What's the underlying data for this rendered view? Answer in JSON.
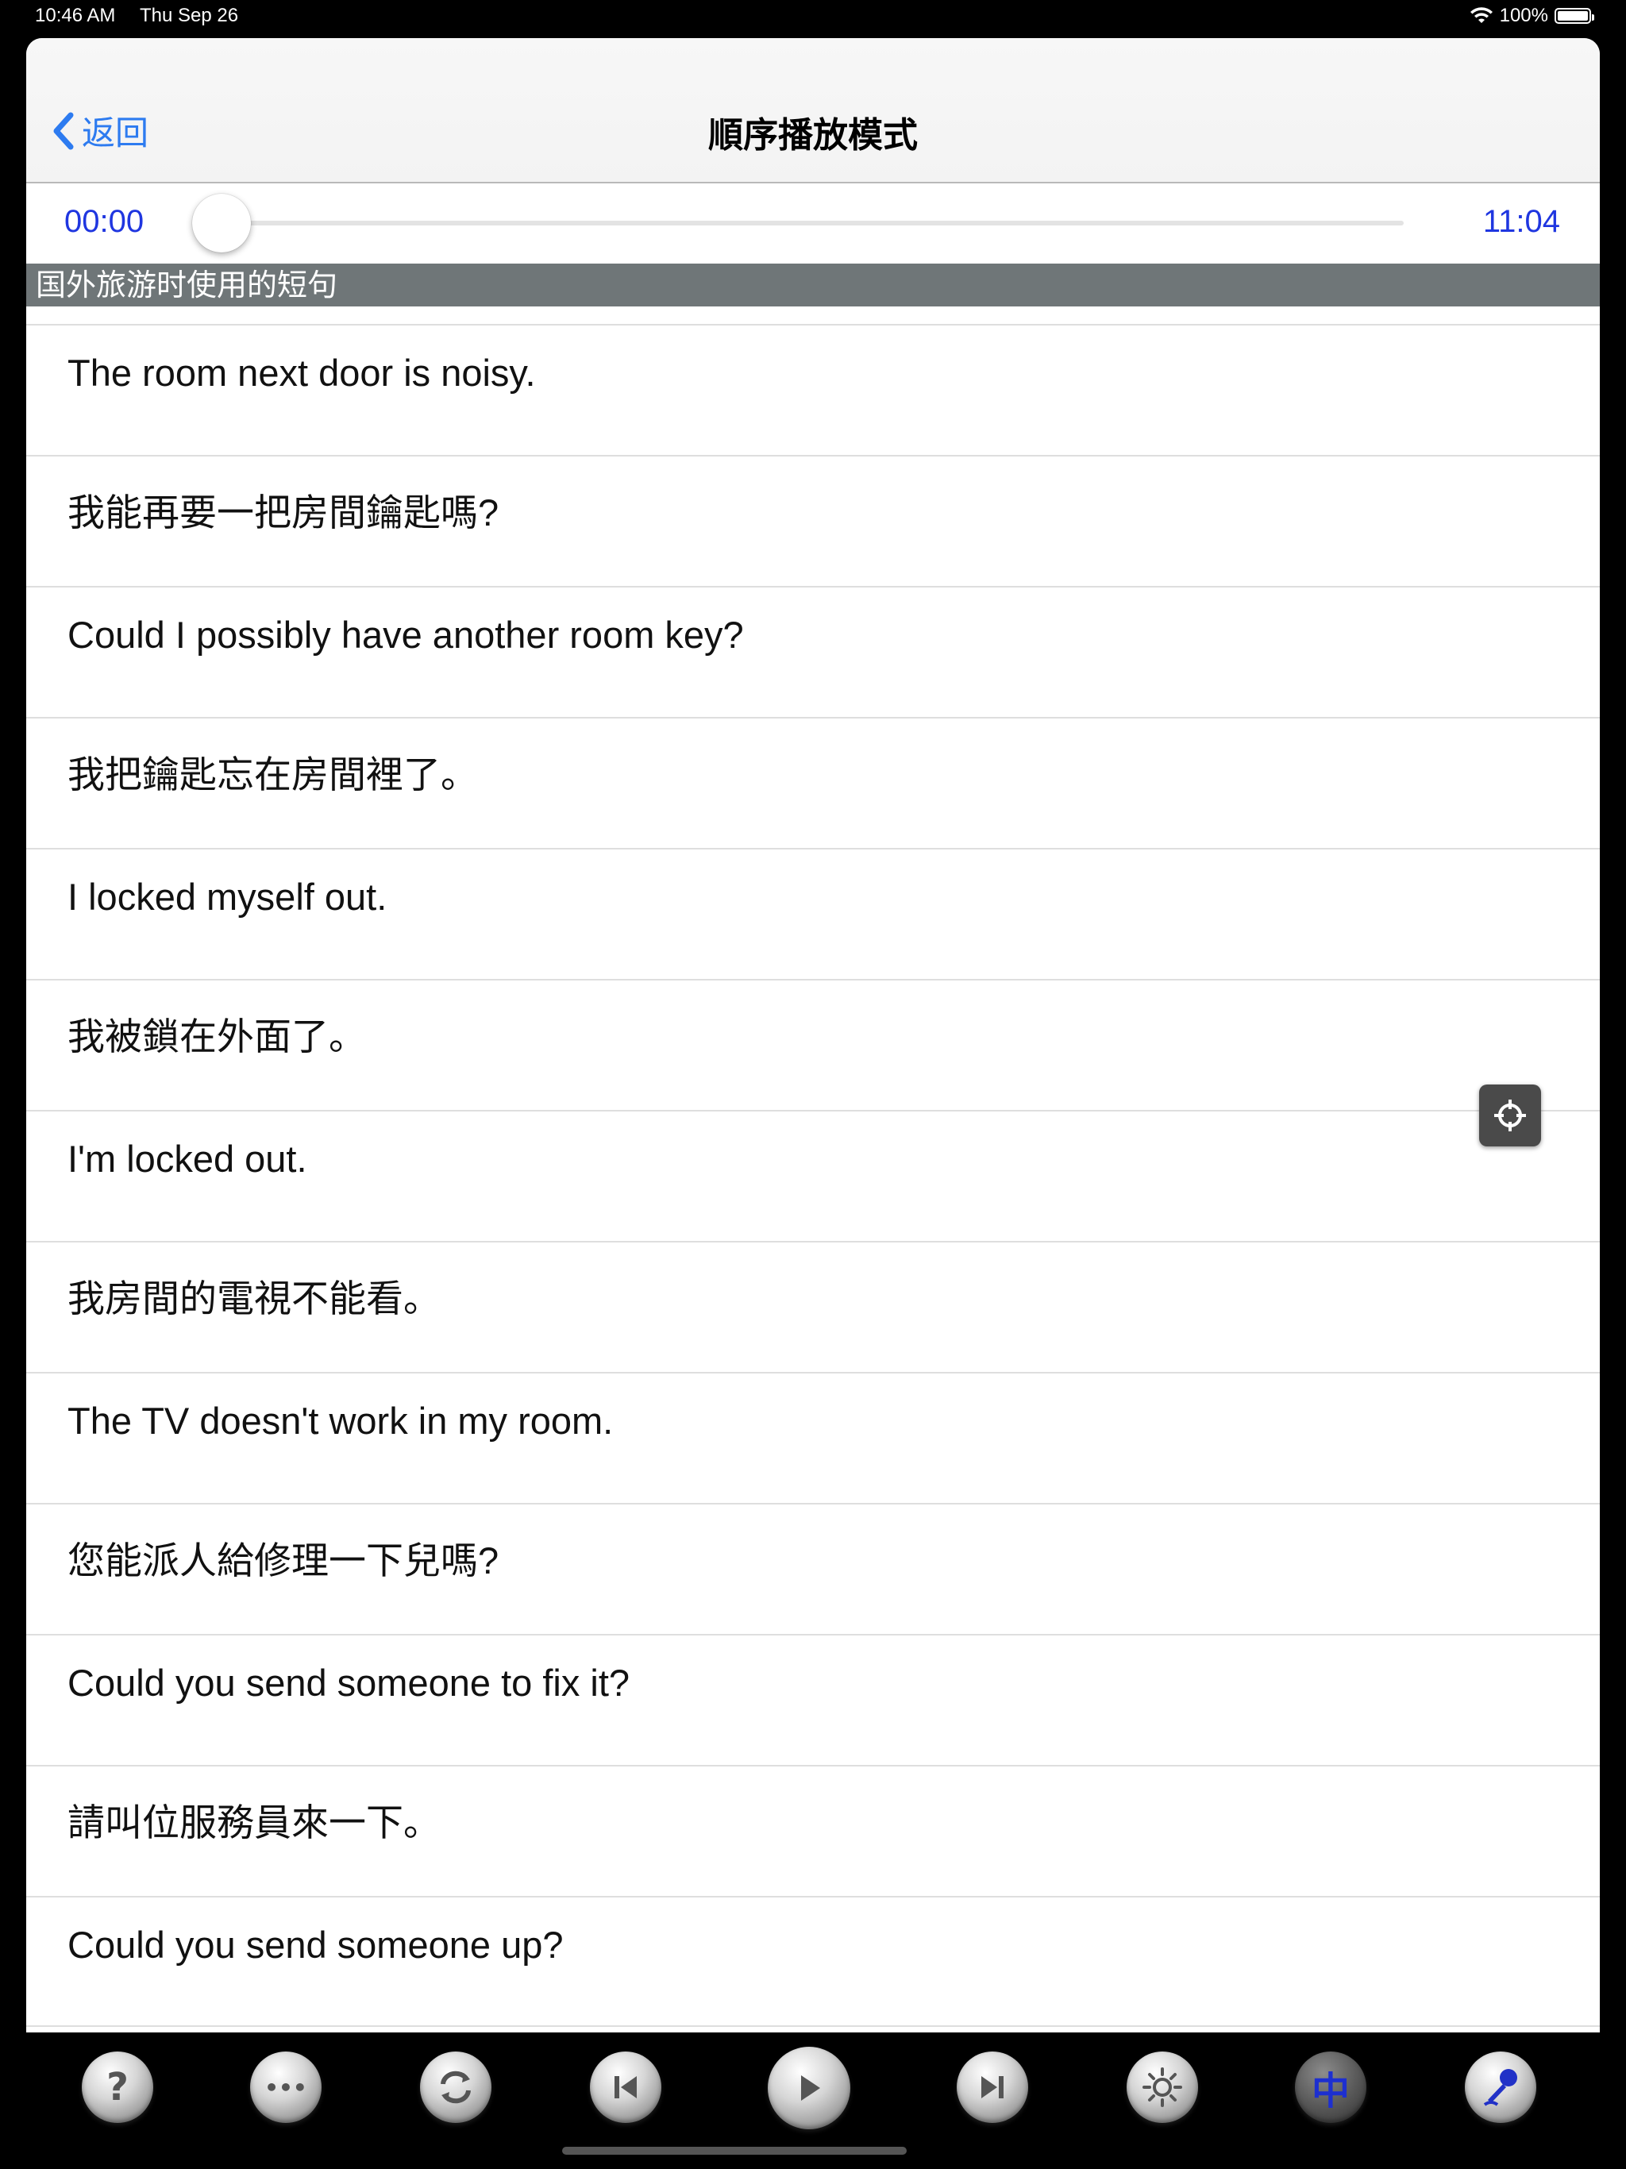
{
  "status": {
    "time": "10:46 AM",
    "date": "Thu Sep 26",
    "battery": "100%"
  },
  "nav": {
    "back_label": "返回",
    "title": "順序播放模式"
  },
  "player": {
    "elapsed": "00:00",
    "total": "11:04",
    "position": 0
  },
  "section": {
    "title": "国外旅游时使用的短句"
  },
  "rows": [
    "The room next door is noisy.",
    "我能再要一把房間鑰匙嗎?",
    "Could I possibly have another room key?",
    "我把鑰匙忘在房間裡了。",
    "I locked myself out.",
    "我被鎖在外面了。",
    "I'm locked out.",
    "我房間的電視不能看。",
    "The TV doesn't work in my room.",
    "您能派人給修理一下兒嗎?",
    "Could you send someone to fix it?",
    "請叫位服務員來一下。",
    "Could you send someone up?"
  ],
  "toolbar": {
    "help": "?",
    "more": "•••",
    "chinese": "中"
  },
  "icons": [
    "chevron-left-icon",
    "wifi-icon",
    "battery-icon",
    "crosshair-icon",
    "help-icon",
    "more-icon",
    "repeat-icon",
    "previous-icon",
    "play-icon",
    "next-icon",
    "brightness-icon",
    "chinese-icon",
    "microphone-icon"
  ],
  "colors": {
    "accent": "#2d7bf0",
    "time_text": "#1f36e0",
    "section_bg": "#6f7678"
  }
}
